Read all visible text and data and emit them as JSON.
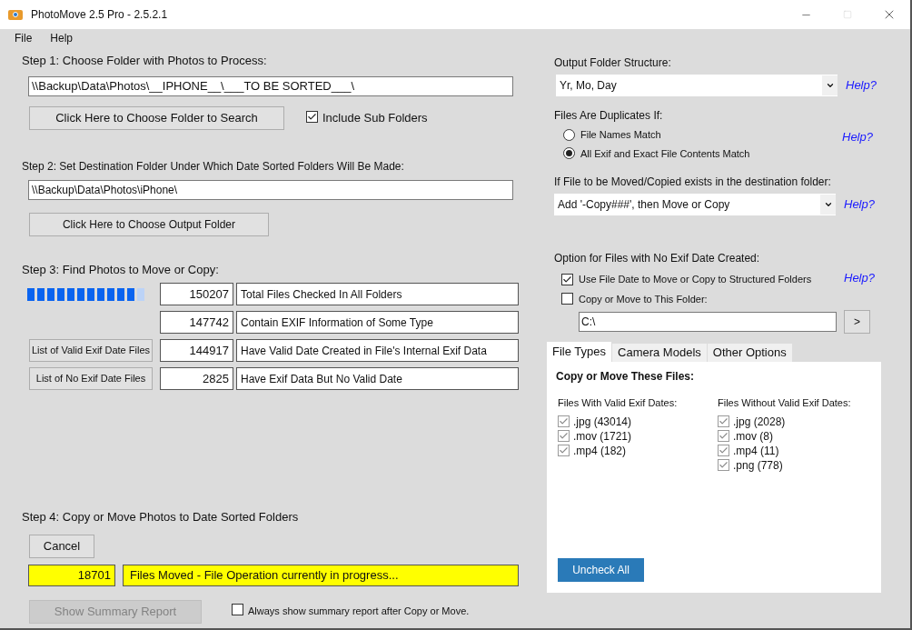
{
  "window": {
    "title": "PhotoMove 2.5 Pro - 2.5.2.1"
  },
  "menu": [
    "File",
    "Help"
  ],
  "step1": {
    "label": "Step 1: Choose Folder with Photos to Process:",
    "path": "\\\\Backup\\Data\\Photos\\__IPHONE__\\___TO BE SORTED___\\",
    "choose_button": "Click Here to Choose Folder to Search",
    "include_subfolders": {
      "label": "Include Sub Folders",
      "checked": true
    }
  },
  "step2": {
    "label": "Step 2: Set Destination Folder Under Which Date Sorted Folders Will Be Made:",
    "path": "\\\\Backup\\Data\\Photos\\iPhone\\",
    "choose_button": "Click Here to Choose Output Folder"
  },
  "step3": {
    "label": "Step 3: Find Photos to Move or Copy:",
    "progress": {
      "level": 0.92
    },
    "rows": [
      {
        "count": "150207",
        "description": "Total Files Checked In All Folders"
      },
      {
        "count": "147742",
        "description": "Contain EXIF Information of Some Type"
      },
      {
        "button": "List of Valid Exif Date Files",
        "count": "144917",
        "description": "Have Valid Date Created in File's Internal Exif Data"
      },
      {
        "button": "List of No Exif Date Files",
        "count": "2825",
        "description": "Have Exif Data But No Valid Date"
      }
    ]
  },
  "step4": {
    "label": "Step 4: Copy or Move Photos to Date Sorted Folders",
    "cancel_button": "Cancel",
    "moved_count": "18701",
    "status": "Files Moved - File Operation currently in progress...",
    "summary_button": {
      "label": "Show Summary Report",
      "disabled": true
    },
    "always_show": {
      "label": "Always show summary report after Copy or Move.",
      "checked": false
    }
  },
  "output_structure": {
    "label": "Output Folder Structure:",
    "value": "Yr, Mo, Day",
    "help": "Help?"
  },
  "duplicates": {
    "label": "Files Are Duplicates If:",
    "help": "Help?",
    "options": [
      {
        "label": "File Names Match",
        "selected": false
      },
      {
        "label": "All Exif and Exact File Contents Match",
        "selected": true
      }
    ]
  },
  "exists": {
    "label": "If File to be Moved/Copied exists in the destination folder:",
    "value": "Add '-Copy###', then Move or Copy",
    "help": "Help?"
  },
  "no_exif": {
    "label": "Option for Files with No Exif Date Created:",
    "help": "Help?",
    "options": [
      {
        "label": "Use File Date to Move or Copy to Structured Folders",
        "checked": true
      },
      {
        "label": "Copy or Move to This Folder:",
        "checked": false
      }
    ],
    "folder": "C:\\",
    "browse": ">"
  },
  "tabs": [
    {
      "label": "File Types",
      "selected": true
    },
    {
      "label": "Camera Models",
      "selected": false
    },
    {
      "label": "Other Options",
      "selected": false
    }
  ],
  "file_types": {
    "heading": "Copy or Move These Files:",
    "columns": [
      {
        "heading": "Files With Valid Exif Dates:",
        "items": [
          {
            "label": ".jpg (43014)",
            "checked": true,
            "disabled": true
          },
          {
            "label": ".mov (1721)",
            "checked": true,
            "disabled": true
          },
          {
            "label": ".mp4 (182)",
            "checked": true,
            "disabled": true
          }
        ]
      },
      {
        "heading": "Files Without Valid Exif Dates:",
        "items": [
          {
            "label": ".jpg (2028)",
            "checked": true,
            "disabled": true
          },
          {
            "label": ".mov (8)",
            "checked": true,
            "disabled": true
          },
          {
            "label": ".mp4 (11)",
            "checked": true,
            "disabled": true
          },
          {
            "label": ".png (778)",
            "checked": true,
            "disabled": true
          }
        ]
      }
    ]
  },
  "uncheck_all": "Uncheck All"
}
